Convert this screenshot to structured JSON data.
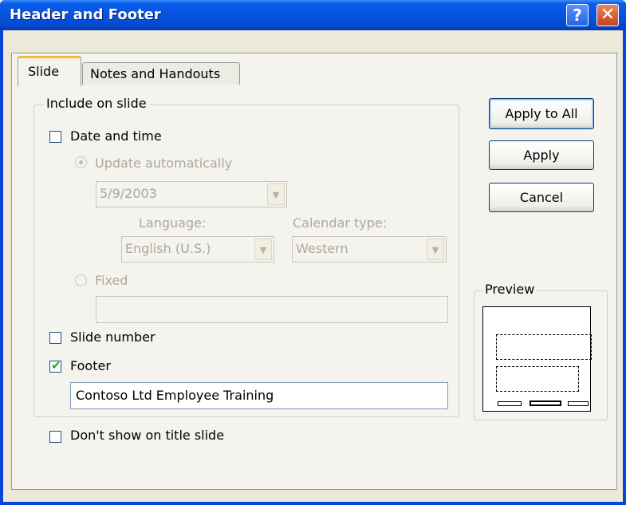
{
  "window": {
    "title": "Header and Footer",
    "help_glyph": "?",
    "close_glyph": "✕"
  },
  "tabs": {
    "slide": "Slide",
    "notes": "Notes and Handouts"
  },
  "include_group": {
    "legend": "Include on slide",
    "date_time": {
      "label": "Date and time",
      "checked": false
    },
    "update_auto": {
      "label": "Update automatically",
      "selected": true
    },
    "date_value": "5/9/2003",
    "language": {
      "label": "Language:",
      "value": "English (U.S.)"
    },
    "calendar": {
      "label": "Calendar type:",
      "value": "Western"
    },
    "fixed": {
      "label": "Fixed",
      "selected": false,
      "value": ""
    },
    "slide_number": {
      "label": "Slide number",
      "checked": false
    },
    "footer": {
      "label": "Footer",
      "checked": true,
      "value": "Contoso Ltd Employee Training",
      "check_glyph": "✔"
    }
  },
  "dont_show_title": {
    "label": "Don't show on title slide",
    "checked": false
  },
  "buttons": {
    "apply_all": "Apply to All",
    "apply": "Apply",
    "cancel": "Cancel"
  },
  "preview": {
    "legend": "Preview"
  },
  "colors": {
    "titlebar": "#0553e0",
    "face": "#ece9d8",
    "tab_panel": "#f4f3ee",
    "tab_accent": "#f8b83a",
    "disabled_text": "#aca899"
  }
}
